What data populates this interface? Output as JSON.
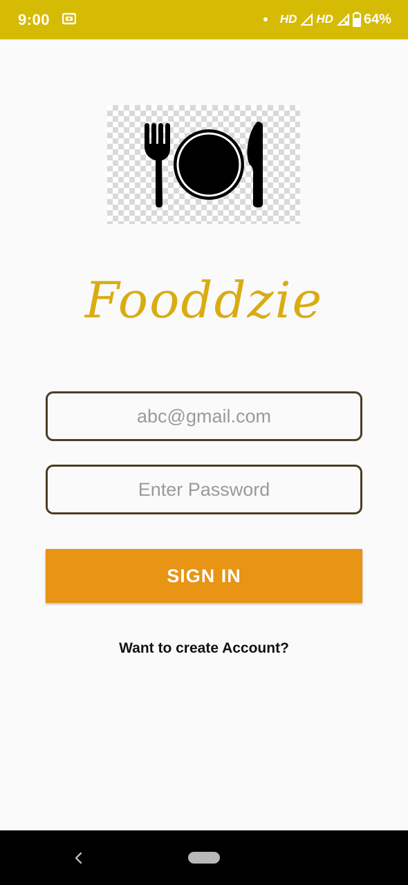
{
  "status_bar": {
    "time": "9:00",
    "network_1": "HD",
    "network_2": "HD",
    "battery": "64%",
    "background_color": "#d6bb05",
    "icons": [
      "screen-record-icon",
      "dot-icon",
      "signal-icon",
      "signal-no-data-icon",
      "battery-icon"
    ]
  },
  "logo": {
    "icon": "plate-fork-knife-icon"
  },
  "brand": {
    "title": "Fooddzie",
    "color": "#d9ac13"
  },
  "form": {
    "email_placeholder": "abc@gmail.com",
    "email_value": "",
    "password_placeholder": "Enter Password",
    "password_value": "",
    "signin_label": "SIGN IN",
    "signin_color": "#e89414",
    "create_account_label": "Want to create Account?"
  },
  "nav_bar": {
    "icons": [
      "back-icon",
      "home-pill-icon"
    ]
  }
}
